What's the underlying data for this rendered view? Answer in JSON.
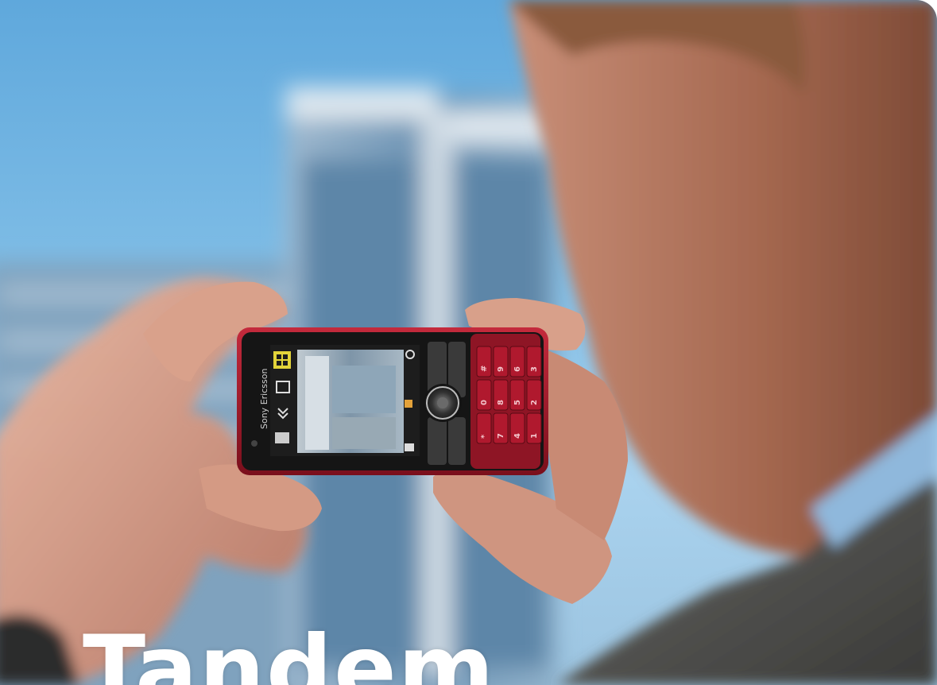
{
  "headline": "Tandem",
  "phone": {
    "brand": "Sony Ericsson",
    "keypad": [
      [
        "1",
        "2",
        "3"
      ],
      [
        "4",
        "5",
        "6"
      ],
      [
        "7",
        "8",
        "9"
      ],
      [
        "*",
        "0",
        "#"
      ]
    ]
  },
  "colors": {
    "sky": "#6fb3e2",
    "phone_body": "#9e1a2a",
    "skin": "#d9a18b"
  }
}
